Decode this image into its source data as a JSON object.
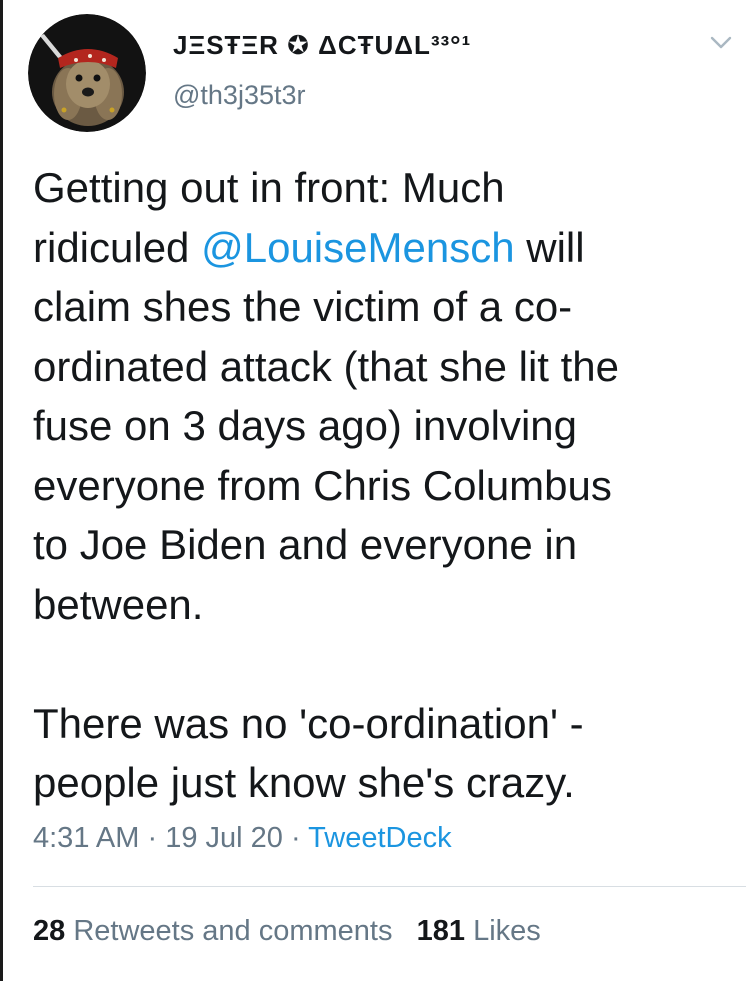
{
  "user": {
    "display_name": "JΞSŦΞR ✪ ΔCŦUΔL³³°¹",
    "handle": "@th3j35t3r",
    "avatar_icon": "dog-pirate-avatar"
  },
  "menu": {
    "icon": "chevron-down-icon"
  },
  "tweet": {
    "text_part1": "Getting out in front: Much\nridiculed ",
    "mention": "@LouiseMensch",
    "text_part2": " will\nclaim shes the victim of a co-\nordinated attack (that she lit the\nfuse on 3 days ago) involving\neveryone from Chris Columbus\nto Joe Biden and everyone in\nbetween.\n\nThere was no 'co-ordination' -\npeople just know she's crazy."
  },
  "meta": {
    "time": "4:31 AM",
    "separator": " · ",
    "date": "19 Jul 20",
    "source": "TweetDeck"
  },
  "stats": {
    "retweets_count": "28",
    "retweets_label": " Retweets and comments",
    "likes_count": "181",
    "likes_label": " Likes"
  },
  "colors": {
    "link": "#1b95e0",
    "secondary_text": "#657786",
    "primary_text": "#14171a"
  }
}
